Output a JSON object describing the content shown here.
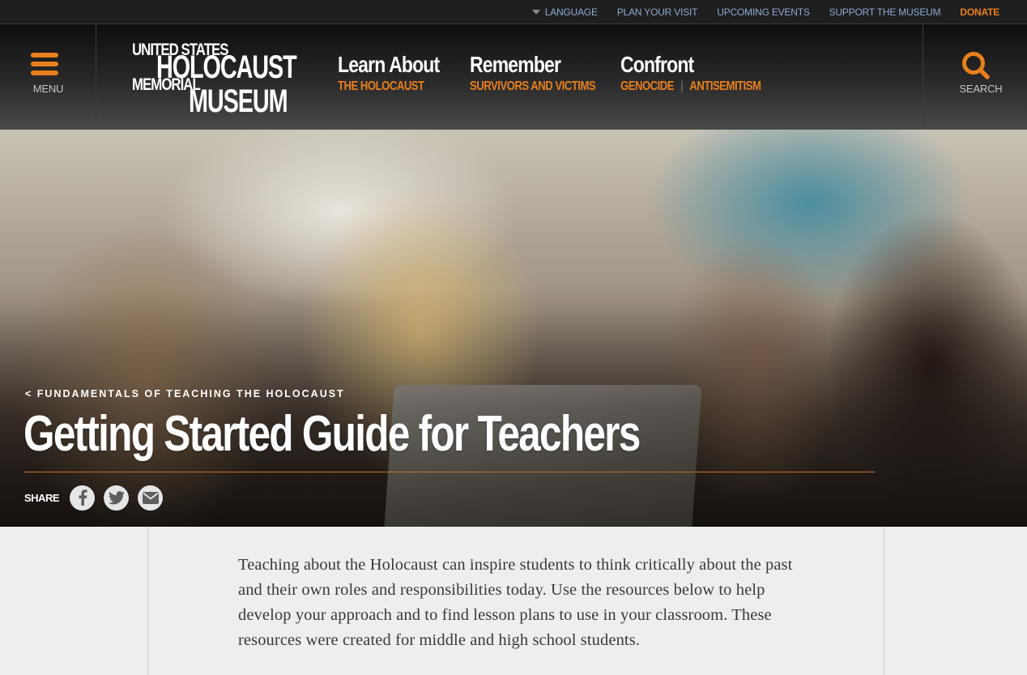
{
  "utility_nav": {
    "language": "LANGUAGE",
    "plan_visit": "PLAN YOUR VISIT",
    "upcoming_events": "UPCOMING EVENTS",
    "support": "SUPPORT THE MUSEUM",
    "donate": "DONATE"
  },
  "header": {
    "menu_label": "MENU",
    "search_label": "SEARCH",
    "logo": {
      "line1": "UNITED STATES",
      "line2": "HOLOCAUST",
      "line3": "MEMORIAL",
      "line4": "MUSEUM"
    },
    "nav": [
      {
        "title": "Learn About",
        "links": [
          "THE HOLOCAUST"
        ]
      },
      {
        "title": "Remember",
        "links": [
          "SURVIVORS AND VICTIMS"
        ]
      },
      {
        "title": "Confront",
        "links": [
          "GENOCIDE",
          "ANTISEMITISM"
        ]
      }
    ],
    "nav_separator": "|"
  },
  "hero": {
    "breadcrumb": "< FUNDAMENTALS OF TEACHING THE HOLOCAUST",
    "title": "Getting Started Guide for Teachers",
    "share_label": "SHARE",
    "share_icons": [
      "facebook-icon",
      "twitter-icon",
      "email-icon"
    ]
  },
  "content": {
    "intro": "Teaching about the Holocaust can inspire students to think critically about the past and their own roles and responsibilities today. Use the resources below to help develop your approach and to find lesson plans to use in your classroom. These resources were created for middle and high school students."
  },
  "colors": {
    "accent_orange": "#e87f1c",
    "utility_link": "#8ea9cf",
    "header_dark": "#1f1f1f",
    "page_bg": "#eeeeee",
    "body_text": "#3a3a3a"
  }
}
